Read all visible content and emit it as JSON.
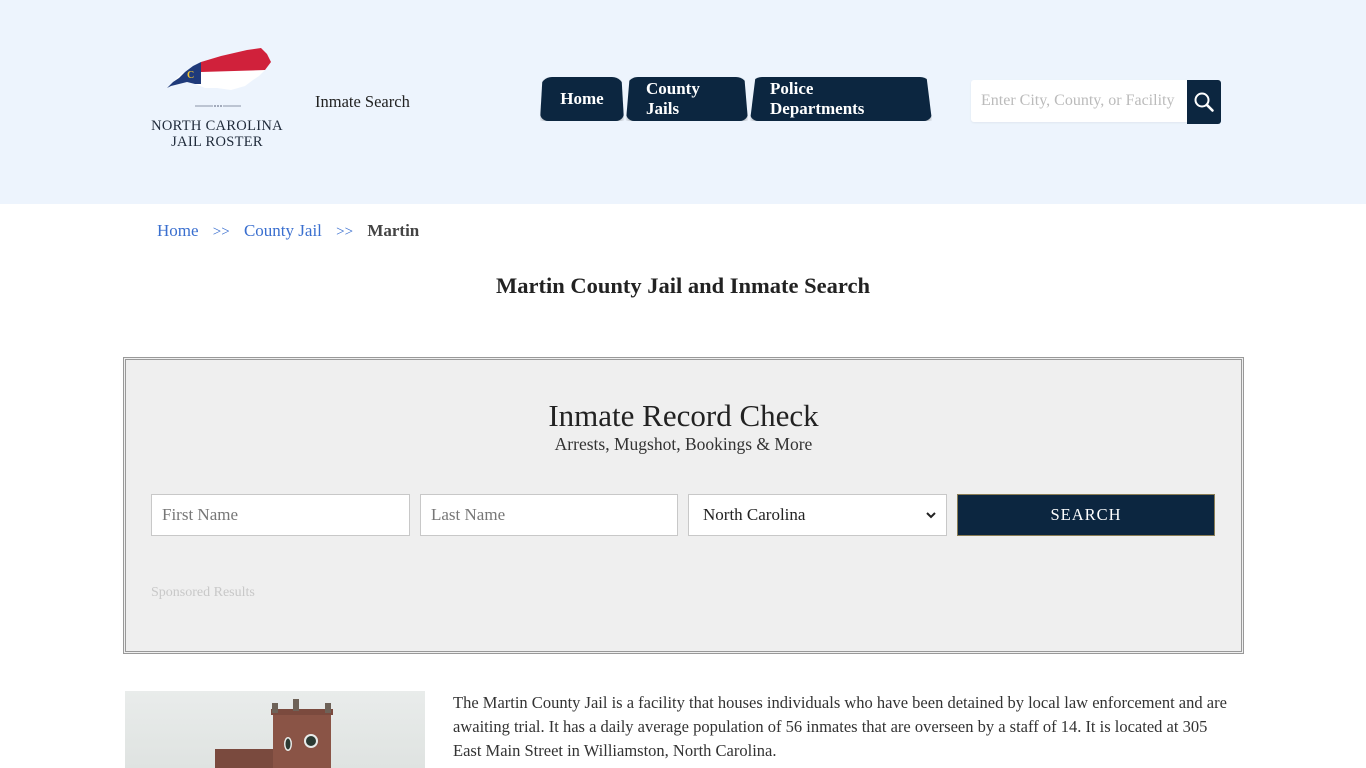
{
  "header": {
    "logo_line1": "NORTH CAROLINA",
    "logo_line2": "JAIL ROSTER",
    "tagline": "Inmate Search",
    "nav": [
      {
        "label": "Home"
      },
      {
        "label": "County Jails"
      },
      {
        "label": "Police Departments"
      }
    ],
    "search_placeholder": "Enter City, County, or Facility",
    "search_icon": "magnifier-icon"
  },
  "breadcrumb": {
    "items": [
      {
        "label": "Home"
      },
      {
        "label": "County Jail"
      }
    ],
    "separator": ">>",
    "current": "Martin"
  },
  "page_title": "Martin County Jail and Inmate Search",
  "record_check": {
    "title": "Inmate Record Check",
    "subtitle": "Arrests, Mugshot, Bookings & More",
    "first_name_placeholder": "First Name",
    "last_name_placeholder": "Last Name",
    "state_selected": "North Carolina",
    "search_label": "SEARCH",
    "sponsored": "Sponsored Results"
  },
  "intro": {
    "text": "The Martin County Jail is a facility that houses individuals who have been detained by local law enforcement and are awaiting trial. It has a daily average population of 56 inmates that are overseen by a staff of 14. It is located at 305 East Main Street in Williamston, North Carolina."
  },
  "colors": {
    "navy": "#0c2640",
    "header_bg": "#edf4fd",
    "link": "#3a6fcf",
    "flag_red": "#d0213b",
    "flag_blue": "#1f3a7a"
  }
}
